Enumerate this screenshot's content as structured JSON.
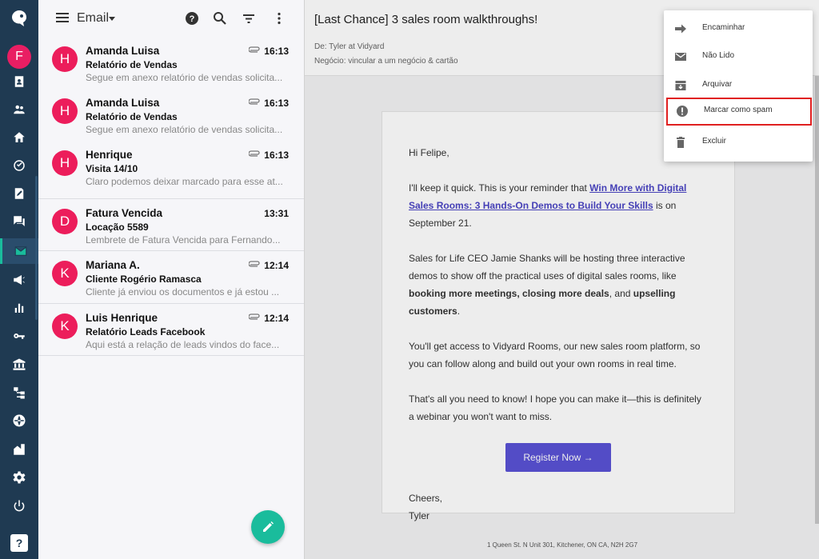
{
  "nav": {
    "user_initial": "F",
    "help_label": "?",
    "items": [
      "contacts-card",
      "people",
      "home",
      "clock-check",
      "edit-doc",
      "chat",
      "email",
      "megaphone",
      "bar-chart",
      "key",
      "bank",
      "hierarchy",
      "globe",
      "buildings",
      "settings",
      "power"
    ]
  },
  "list": {
    "title": "Email",
    "emails": [
      {
        "initial": "H",
        "name": "Amanda Luisa",
        "subject": "Relatório de Vendas",
        "preview": "Segue em anexo relatório de vendas solicita...",
        "time": "16:13",
        "attachment": true
      },
      {
        "initial": "H",
        "name": "Amanda Luisa",
        "subject": "Relatório de Vendas",
        "preview": "Segue em anexo relatório de vendas solicita...",
        "time": "16:13",
        "attachment": true
      },
      {
        "initial": "H",
        "name": "Henrique",
        "subject": "Visita 14/10",
        "preview": "Claro podemos deixar marcado para esse at...",
        "time": "16:13",
        "attachment": true
      },
      {
        "initial": "D",
        "name": "Fatura Vencida",
        "subject": "Locação 5589",
        "preview": "Lembrete de Fatura Vencida para Fernando...",
        "time": "13:31",
        "attachment": false
      },
      {
        "initial": "K",
        "name": "Mariana A.",
        "subject": "Cliente Rogério Ramasca",
        "preview": "Cliente já enviou os documentos e já estou ...",
        "time": "12:14",
        "attachment": true
      },
      {
        "initial": "K",
        "name": "Luis Henrique",
        "subject": "Relatório Leads Facebook",
        "preview": "Aqui está a relação de leads vindos do face...",
        "time": "12:14",
        "attachment": true
      }
    ]
  },
  "message": {
    "subject": "[Last Chance] 3 sales room walkthroughs!",
    "from": "De:  Tyler at Vidyard",
    "deal": "Negócio:  vincular a um negócio & cartão",
    "greeting": "Hi Felipe,",
    "p1_pre": "I'll keep it quick. This is your reminder that ",
    "p1_link": "Win More with Digital Sales Rooms: 3 Hands-On Demos to Build Your Skills",
    "p1_post": " is on September 21.",
    "p2_a": "Sales for Life CEO Jamie Shanks will be hosting three interactive demos to show off the practical uses of digital sales rooms, like ",
    "p2_b1": "booking more meetings, closing more deals",
    "p2_c": ", and ",
    "p2_b2": "upselling customers",
    "p2_d": ".",
    "p3": "You'll get access to Vidyard Rooms, our new sales room platform, so you can follow along and build out your own rooms in real time.",
    "p4": "That's all you need to know! I hope you can make it—this is definitely a webinar you won't want to miss.",
    "button": "Register Now →",
    "signoff": "Cheers,",
    "signature": "Tyler",
    "footer": "1 Queen St. N Unit 301, Kitchener, ON CA, N2H 2G7"
  },
  "menu": {
    "items": [
      {
        "label": "Encaminhar",
        "icon": "forward-icon"
      },
      {
        "label": "Não Lido",
        "icon": "envelope-icon"
      },
      {
        "label": "Arquivar",
        "icon": "archive-icon"
      },
      {
        "label": "Marcar como spam",
        "icon": "spam-icon",
        "highlighted": true
      },
      {
        "label": "Excluir",
        "icon": "trash-icon"
      }
    ]
  },
  "colors": {
    "rail": "#1f3a52",
    "accent": "#1abc9c",
    "avatar": "#ec1d5b",
    "button": "#5a52d6",
    "highlight": "#e02020"
  }
}
